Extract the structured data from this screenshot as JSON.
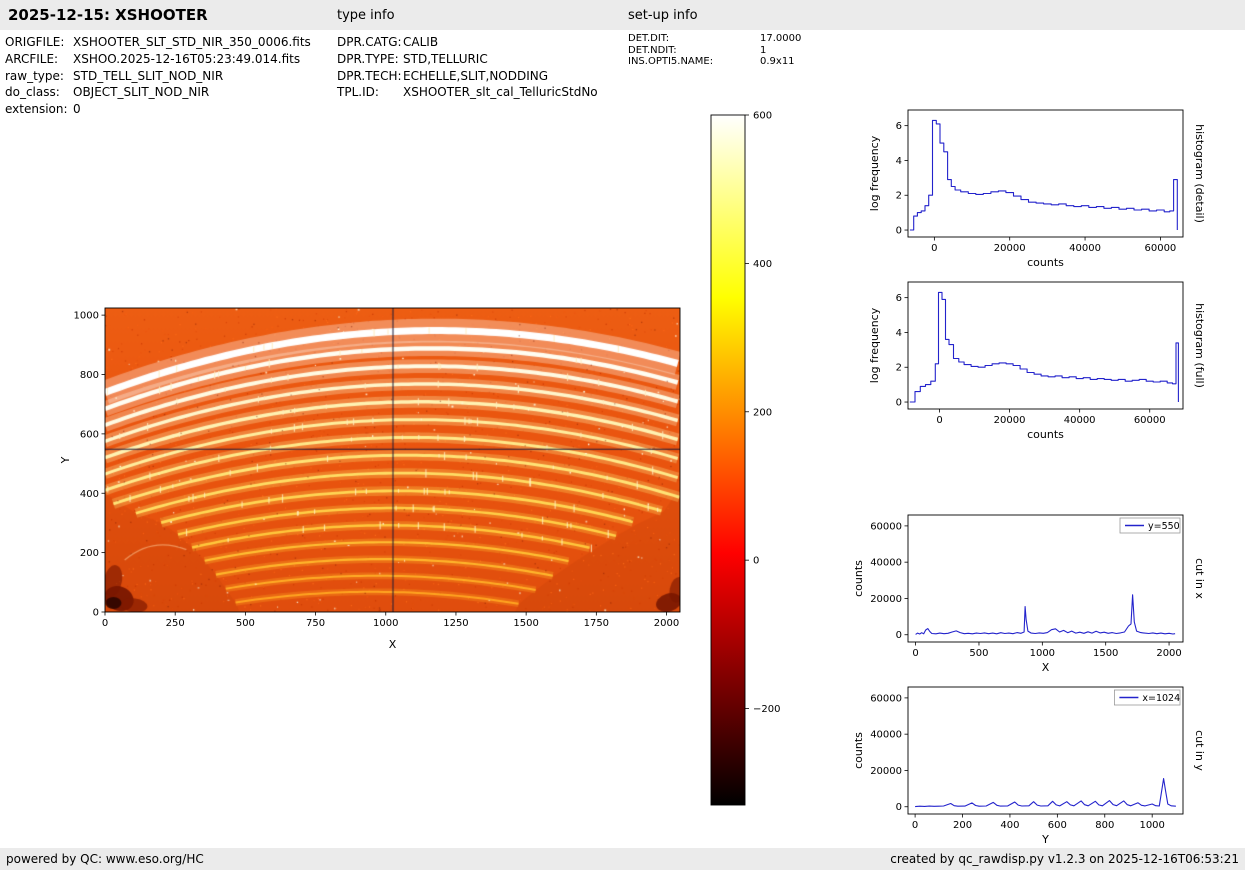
{
  "header": {
    "title": "2025-12-15: XSHOOTER",
    "type_info_label": "type info",
    "setup_info_label": "set-up info"
  },
  "file_info": [
    {
      "label": "ORIGFILE:",
      "value": "XSHOOTER_SLT_STD_NIR_350_0006.fits"
    },
    {
      "label": "ARCFILE:",
      "value": "XSHOO.2025-12-16T05:23:49.014.fits"
    },
    {
      "label": "raw_type:",
      "value": "STD_TELL_SLIT_NOD_NIR"
    },
    {
      "label": "do_class:",
      "value": "OBJECT_SLIT_NOD_NIR"
    },
    {
      "label": "extension:",
      "value": "0"
    }
  ],
  "type_info": [
    {
      "label": "DPR.CATG:",
      "value": "CALIB"
    },
    {
      "label": "DPR.TYPE:",
      "value": "STD,TELLURIC"
    },
    {
      "label": "DPR.TECH:",
      "value": "ECHELLE,SLIT,NODDING"
    },
    {
      "label": "TPL.ID:",
      "value": "XSHOOTER_slt_cal_TelluricStdNo"
    }
  ],
  "setup_info": [
    {
      "label": "DET.DIT:",
      "value": "17.0000"
    },
    {
      "label": "DET.NDIT:",
      "value": "1"
    },
    {
      "label": "INS.OPTI5.NAME:",
      "value": "0.9x11"
    }
  ],
  "footer": {
    "left": "powered by QC: www.eso.org/HC",
    "right": "created by qc_rawdisp.py v1.2.3 on 2025-12-16T06:53:21"
  },
  "chart_data": [
    {
      "id": "raw_frame",
      "type": "heatmap",
      "xlabel": "X",
      "ylabel": "Y",
      "xlim": [
        0,
        2048
      ],
      "ylim": [
        0,
        1024
      ],
      "xticks": [
        0,
        250,
        500,
        750,
        1000,
        1250,
        1500,
        1750,
        2000
      ],
      "yticks": [
        0,
        200,
        400,
        600,
        800,
        1000
      ],
      "crosshair": {
        "x": 1024,
        "y": 550
      },
      "colormap": "hot",
      "background_color": "#e8520e",
      "arc_curvature": 0.00015,
      "arcs": [
        {
          "apex_x": 1180,
          "apex_y": 948,
          "x0": 0,
          "x1": 2048,
          "w": 7,
          "color": "#ffffff"
        },
        {
          "apex_x": 1165,
          "apex_y": 888,
          "x0": 0,
          "x1": 2048,
          "w": 4.5,
          "color": "#fffdf2"
        },
        {
          "apex_x": 1150,
          "apex_y": 828,
          "x0": 0,
          "x1": 2048,
          "w": 4,
          "color": "#fffae2"
        },
        {
          "apex_x": 1135,
          "apex_y": 768,
          "x0": 0,
          "x1": 2048,
          "w": 3.5,
          "color": "#fff6cb"
        },
        {
          "apex_x": 1120,
          "apex_y": 708,
          "x0": 0,
          "x1": 2048,
          "w": 3.5,
          "color": "#fff2b2"
        },
        {
          "apex_x": 1105,
          "apex_y": 648,
          "x0": 0,
          "x1": 2048,
          "w": 3,
          "color": "#ffee9e"
        },
        {
          "apex_x": 1090,
          "apex_y": 588,
          "x0": 0,
          "x1": 2048,
          "w": 3,
          "color": "#ffe98a"
        },
        {
          "apex_x": 1075,
          "apex_y": 528,
          "x0": 30,
          "x1": 2048,
          "w": 3,
          "color": "#ffe376"
        },
        {
          "apex_x": 1060,
          "apex_y": 468,
          "x0": 110,
          "x1": 1990,
          "w": 2.8,
          "color": "#ffdd64"
        },
        {
          "apex_x": 1045,
          "apex_y": 408,
          "x0": 200,
          "x1": 1900,
          "w": 2.8,
          "color": "#ffd654"
        },
        {
          "apex_x": 1030,
          "apex_y": 350,
          "x0": 260,
          "x1": 1820,
          "w": 2.5,
          "color": "#ffcf47"
        },
        {
          "apex_x": 1015,
          "apex_y": 292,
          "x0": 310,
          "x1": 1745,
          "w": 2.5,
          "color": "#ffc73c"
        },
        {
          "apex_x": 1000,
          "apex_y": 235,
          "x0": 355,
          "x1": 1670,
          "w": 2.2,
          "color": "#ffbf33"
        },
        {
          "apex_x": 985,
          "apex_y": 178,
          "x0": 395,
          "x1": 1600,
          "w": 2.2,
          "color": "#ffb62c"
        },
        {
          "apex_x": 970,
          "apex_y": 122,
          "x0": 430,
          "x1": 1535,
          "w": 2,
          "color": "#ffad26"
        },
        {
          "apex_x": 955,
          "apex_y": 68,
          "x0": 465,
          "x1": 1475,
          "w": 2,
          "color": "#ffa521"
        }
      ]
    },
    {
      "id": "colorbar",
      "type": "colorbar",
      "colormap": "hot",
      "vmin": -330,
      "vmax": 600,
      "ticks": [
        600,
        400,
        200,
        0,
        -200
      ]
    },
    {
      "id": "hist_detail",
      "type": "step",
      "xlabel": "counts",
      "ylabel": "log frequency",
      "right_label": "histogram (detail)",
      "color": "#2323cc",
      "xlim": [
        -7000,
        66000
      ],
      "ylim": [
        -0.4,
        6.9
      ],
      "xticks": [
        0,
        20000,
        40000,
        60000
      ],
      "yticks": [
        0,
        2,
        4,
        6
      ],
      "x": [
        -6500,
        -5500,
        -4500,
        -3500,
        -2500,
        -1500,
        -500,
        500,
        1500,
        2500,
        3500,
        4500,
        5500,
        7000,
        9000,
        11000,
        13000,
        15000,
        17000,
        19000,
        21000,
        23000,
        25000,
        27000,
        29000,
        31000,
        33000,
        35000,
        37000,
        39000,
        41000,
        43000,
        45000,
        47000,
        49000,
        51000,
        53000,
        55000,
        57000,
        59000,
        61000,
        62500,
        63500,
        64500
      ],
      "y": [
        0.0,
        0.8,
        1.0,
        1.1,
        1.4,
        2.0,
        6.3,
        6.1,
        5.0,
        4.5,
        2.9,
        2.5,
        2.3,
        2.2,
        2.1,
        2.05,
        2.1,
        2.2,
        2.25,
        2.15,
        1.95,
        1.75,
        1.6,
        1.55,
        1.5,
        1.45,
        1.5,
        1.4,
        1.35,
        1.4,
        1.3,
        1.35,
        1.25,
        1.3,
        1.2,
        1.25,
        1.15,
        1.2,
        1.1,
        1.15,
        1.05,
        1.1,
        2.9,
        0.0
      ]
    },
    {
      "id": "hist_full",
      "type": "step",
      "xlabel": "counts",
      "ylabel": "log frequency",
      "right_label": "histogram (full)",
      "color": "#2323cc",
      "xlim": [
        -9000,
        69500
      ],
      "ylim": [
        -0.4,
        6.9
      ],
      "xticks": [
        0,
        20000,
        40000,
        60000
      ],
      "yticks": [
        0,
        2,
        4,
        6
      ],
      "x": [
        -8500,
        -7000,
        -5500,
        -4000,
        -2500,
        -1200,
        -300,
        700,
        1700,
        2700,
        4000,
        5500,
        7000,
        9000,
        11000,
        13000,
        15000,
        17000,
        19000,
        21000,
        23000,
        25000,
        27000,
        29000,
        31000,
        33000,
        35000,
        37000,
        39000,
        41000,
        43000,
        45000,
        47000,
        49000,
        51000,
        53000,
        55000,
        57000,
        59000,
        61000,
        63000,
        65000,
        66500,
        67500,
        68200
      ],
      "y": [
        0.0,
        0.6,
        0.9,
        1.0,
        1.2,
        2.2,
        6.3,
        5.9,
        3.6,
        3.3,
        2.5,
        2.3,
        2.15,
        2.05,
        2.0,
        2.1,
        2.2,
        2.25,
        2.2,
        2.1,
        1.9,
        1.7,
        1.6,
        1.5,
        1.45,
        1.5,
        1.4,
        1.45,
        1.35,
        1.4,
        1.3,
        1.35,
        1.3,
        1.25,
        1.3,
        1.2,
        1.25,
        1.3,
        1.2,
        1.15,
        1.2,
        1.1,
        1.05,
        3.4,
        0.0
      ]
    },
    {
      "id": "cut_x",
      "type": "line",
      "xlabel": "X",
      "ylabel": "counts",
      "right_label": "cut in x",
      "legend": "y=550",
      "color": "#2323cc",
      "xlim": [
        -60,
        2110
      ],
      "ylim": [
        -4000,
        66000
      ],
      "xticks": [
        0,
        500,
        1000,
        1500,
        2000
      ],
      "yticks": [
        0,
        20000,
        40000,
        60000
      ],
      "x": [
        0,
        16,
        32,
        48,
        64,
        80,
        96,
        112,
        128,
        160,
        192,
        224,
        256,
        288,
        320,
        352,
        384,
        416,
        448,
        480,
        512,
        544,
        576,
        608,
        640,
        672,
        704,
        736,
        768,
        800,
        832,
        856,
        864,
        872,
        886,
        912,
        944,
        976,
        1008,
        1040,
        1072,
        1104,
        1136,
        1168,
        1200,
        1232,
        1264,
        1296,
        1328,
        1360,
        1392,
        1424,
        1456,
        1488,
        1520,
        1552,
        1584,
        1616,
        1648,
        1680,
        1700,
        1712,
        1726,
        1744,
        1776,
        1808,
        1840,
        1872,
        1904,
        1936,
        1968,
        2000,
        2030,
        2048
      ],
      "y": [
        200,
        900,
        400,
        1100,
        500,
        2600,
        3400,
        1800,
        700,
        500,
        900,
        600,
        800,
        1500,
        2100,
        1200,
        600,
        800,
        500,
        900,
        700,
        1000,
        600,
        900,
        500,
        1100,
        700,
        900,
        600,
        1200,
        800,
        1500,
        15500,
        8500,
        2000,
        900,
        700,
        1000,
        800,
        1200,
        2800,
        3300,
        1500,
        2400,
        1100,
        2000,
        900,
        1400,
        800,
        1600,
        900,
        1900,
        1000,
        1400,
        800,
        1200,
        700,
        1000,
        1500,
        4800,
        6000,
        22000,
        7000,
        2000,
        1200,
        900,
        700,
        1000,
        600,
        900,
        500,
        800,
        400,
        600
      ]
    },
    {
      "id": "cut_y",
      "type": "line",
      "xlabel": "Y",
      "ylabel": "counts",
      "right_label": "cut in y",
      "legend": "x=1024",
      "color": "#2323cc",
      "xlim": [
        -30,
        1130
      ],
      "ylim": [
        -4000,
        66000
      ],
      "xticks": [
        0,
        200,
        400,
        600,
        800,
        1000
      ],
      "yticks": [
        0,
        20000,
        40000,
        60000
      ],
      "x": [
        0,
        20,
        40,
        60,
        80,
        100,
        120,
        150,
        165,
        180,
        210,
        240,
        255,
        270,
        300,
        330,
        345,
        360,
        390,
        420,
        435,
        450,
        480,
        500,
        515,
        530,
        560,
        580,
        595,
        610,
        640,
        655,
        670,
        700,
        715,
        730,
        760,
        775,
        790,
        820,
        835,
        850,
        880,
        895,
        910,
        940,
        955,
        970,
        1000,
        1015,
        1030,
        1048,
        1056,
        1066,
        1080,
        1100
      ],
      "y": [
        100,
        300,
        200,
        350,
        250,
        300,
        400,
        1800,
        600,
        300,
        350,
        2100,
        700,
        300,
        400,
        2400,
        800,
        350,
        400,
        2600,
        900,
        400,
        500,
        2800,
        900,
        400,
        500,
        3000,
        1000,
        450,
        2800,
        1000,
        500,
        3200,
        1100,
        500,
        3000,
        1000,
        500,
        3400,
        1200,
        550,
        3200,
        1100,
        500,
        2200,
        800,
        450,
        1500,
        600,
        400,
        15500,
        9000,
        1500,
        500,
        300
      ]
    }
  ]
}
